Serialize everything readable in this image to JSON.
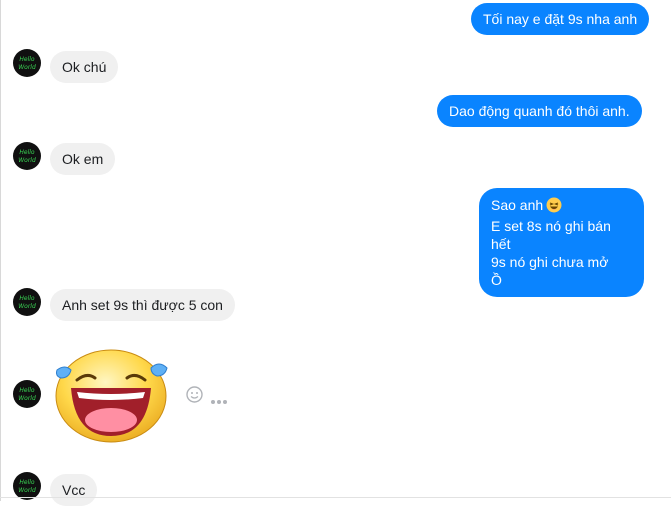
{
  "messages": [
    {
      "side": "out",
      "text": "Tối nay e đặt 9s nha anh"
    },
    {
      "side": "in",
      "text": "Ok chú"
    },
    {
      "side": "out",
      "text": "Dao động quanh đó thôi anh."
    },
    {
      "side": "in",
      "text": "Ok em"
    },
    {
      "side": "out",
      "lines": [
        "Sao anh",
        "E set 8s nó ghi bán hết",
        "9s nó ghi chưa mở",
        "Ồ"
      ],
      "emoji": "laughing-face"
    },
    {
      "side": "in",
      "text": "Anh set 9s thì được 5 con"
    },
    {
      "side": "in",
      "sticker": "laughing-tears-sticker"
    },
    {
      "side": "in",
      "text": "Vcc"
    }
  ],
  "avatar": {
    "caption_line1": "Hello",
    "caption_line2": "World"
  },
  "colors": {
    "outgoing": "#0a84ff",
    "incoming": "#f0f0f0",
    "avatar_text": "#39d353"
  },
  "icons": {
    "emoji": "smiley-icon",
    "more": "more-options-icon"
  }
}
